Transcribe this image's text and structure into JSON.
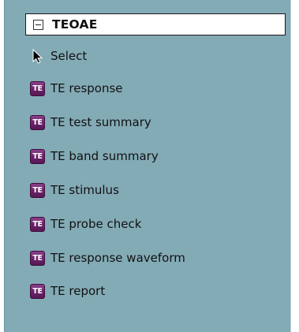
{
  "group": {
    "title": "TEOAE",
    "icon": "collapse-minus-icon"
  },
  "select": {
    "label": "Select",
    "icon": "arrow-cursor-icon"
  },
  "items": [
    {
      "icon_text": "TE",
      "label": "TE response"
    },
    {
      "icon_text": "TE",
      "label": "TE test summary"
    },
    {
      "icon_text": "TE",
      "label": "TE band summary"
    },
    {
      "icon_text": "TE",
      "label": "TE stimulus"
    },
    {
      "icon_text": "TE",
      "label": "TE probe check"
    },
    {
      "icon_text": "TE",
      "label": "TE response waveform"
    },
    {
      "icon_text": "TE",
      "label": "TE report"
    }
  ],
  "colors": {
    "panel_background": "#83abb6",
    "icon_purple": "#6a2167",
    "header_background": "#ffffff"
  }
}
